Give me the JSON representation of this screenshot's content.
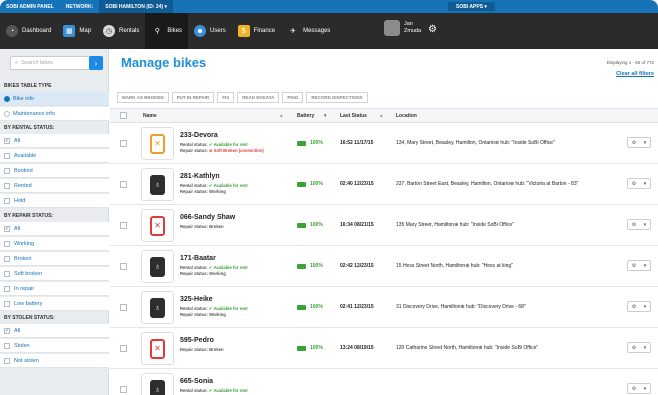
{
  "topbar": {
    "admin": "SOBI ADMIN PANEL",
    "network_label": "NETWORK:",
    "network_value": "SOBI HAMILTON (ID: 24) ▾",
    "apps": "SOBI APPS ▾"
  },
  "nav": {
    "items": [
      {
        "label": "Dashboard",
        "icon": "dashboard-icon"
      },
      {
        "label": "Map",
        "icon": "map-icon"
      },
      {
        "label": "Rentals",
        "icon": "rentals-icon"
      },
      {
        "label": "Bikes",
        "icon": "bike-icon"
      },
      {
        "label": "Users",
        "icon": "users-icon"
      },
      {
        "label": "Finance",
        "icon": "finance-icon"
      },
      {
        "label": "Messages",
        "icon": "messages-icon"
      }
    ],
    "user_first": "Jan",
    "user_last": "Zmuda"
  },
  "sidebar": {
    "search_placeholder": "Search bikes",
    "table_type_title": "BIKES TABLE TYPE",
    "table_types": [
      "Bike info",
      "Maintenance info"
    ],
    "rental_title": "BY RENTAL STATUS:",
    "rental": [
      "All",
      "Available",
      "Booked",
      "Rented",
      "Hold"
    ],
    "repair_title": "BY REPAIR STATUS:",
    "repair": [
      "All",
      "Working",
      "Broken",
      "Soft broken",
      "In repair",
      "Low battery"
    ],
    "stolen_title": "BY STOLEN STATUS:",
    "stolen": [
      "All",
      "Stolen",
      "Not stolen"
    ]
  },
  "main": {
    "title": "Manage bikes",
    "displaying": "Displaying 1 - 50 of 772",
    "clear": "Clear all filters",
    "actions": [
      "MARK AS BROKEN",
      "PUT IN REPAIR",
      "FIX",
      "READ NVDATA",
      "PING",
      "RECORD INSPECTIONS"
    ],
    "columns": {
      "name": "Name",
      "battery": "Battery",
      "last_status": "Last Status",
      "location": "Location"
    },
    "rental_label": "Rental status:",
    "repair_label": "Repair status:",
    "rows": [
      {
        "name": "233-Devora",
        "rental": "Available for rent",
        "repair": "Soft Broken (connection)",
        "battery": "100%",
        "last": "16:52 11/17/15",
        "location": "134, Mary Street, Beasley, Hamilton, Ontario⊕ hub: \"Inside SoBi Office\"",
        "pin": "orange"
      },
      {
        "name": "281-Kathlyn",
        "rental": "Available for rent",
        "repair": "Working",
        "battery": "100%",
        "last": "02:40 12/23/15",
        "location": "237, Barton Street East, Beasley, Hamilton, Ontario⊕ hub: \"Victoria at Barton - 83\"",
        "pin": "dark"
      },
      {
        "name": "066-Sandy Shaw",
        "rental": "",
        "repair": "Broken",
        "battery": "100%",
        "last": "16:34 08/21/15",
        "location": "135 Mary Street, Hamilton⊕ hub: \"Inside SoBi Office\"",
        "pin": "red"
      },
      {
        "name": "171-Baatar",
        "rental": "Available for rent",
        "repair": "Working",
        "battery": "100%",
        "last": "02:42 12/23/15",
        "location": "15 Hess Street North, Hamilton⊕ hub: \"Hess at king\"",
        "pin": "dark"
      },
      {
        "name": "325-Heike",
        "rental": "Available for rent",
        "repair": "Working",
        "battery": "100%",
        "last": "02:41 12/23/15",
        "location": "31 Discovery Drive, Hamilton⊕ hub: \"Discovery Drive - 68\"",
        "pin": "dark"
      },
      {
        "name": "595-Pedro",
        "rental": "",
        "repair": "Broken",
        "battery": "100%",
        "last": "13:24 08/19/15",
        "location": "120 Catharine Street North, Hamilton⊕ hub: \"Inside SoBi Office\"",
        "pin": "red"
      },
      {
        "name": "665-Sonia",
        "rental": "Available for rent",
        "repair": "",
        "battery": "",
        "last": "",
        "location": "",
        "pin": "dark"
      }
    ]
  }
}
